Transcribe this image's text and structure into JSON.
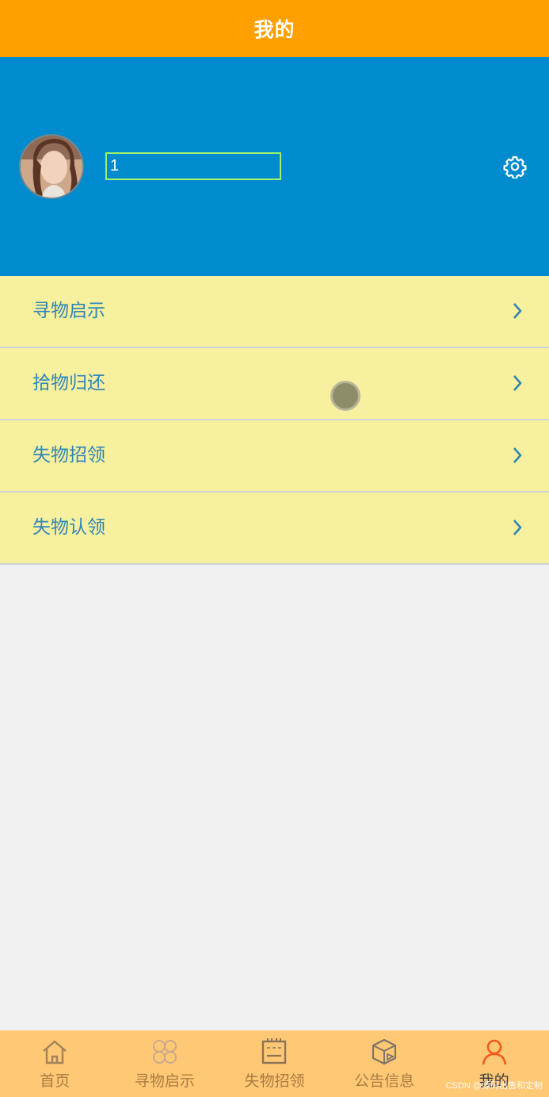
{
  "header": {
    "title": "我的"
  },
  "profile": {
    "username": "1"
  },
  "menu": {
    "items": [
      {
        "label": "寻物启示"
      },
      {
        "label": "拾物归还"
      },
      {
        "label": "失物招领"
      },
      {
        "label": "失物认领"
      }
    ]
  },
  "tabbar": {
    "tabs": [
      {
        "label": "首页",
        "icon": "home-icon"
      },
      {
        "label": "寻物启示",
        "icon": "grid-icon"
      },
      {
        "label": "失物招领",
        "icon": "notebook-icon"
      },
      {
        "label": "公告信息",
        "icon": "box-icon"
      },
      {
        "label": "我的",
        "icon": "person-icon",
        "active": true
      }
    ]
  },
  "watermark": "CSDN @源码出售和定制",
  "colors": {
    "header": "#ff9f00",
    "profile_bg": "#008bcf",
    "menu_bg": "#f7f09e",
    "menu_text": "#2f86b8",
    "tabbar_bg": "#ffc875",
    "active_icon": "#f05b1c"
  }
}
